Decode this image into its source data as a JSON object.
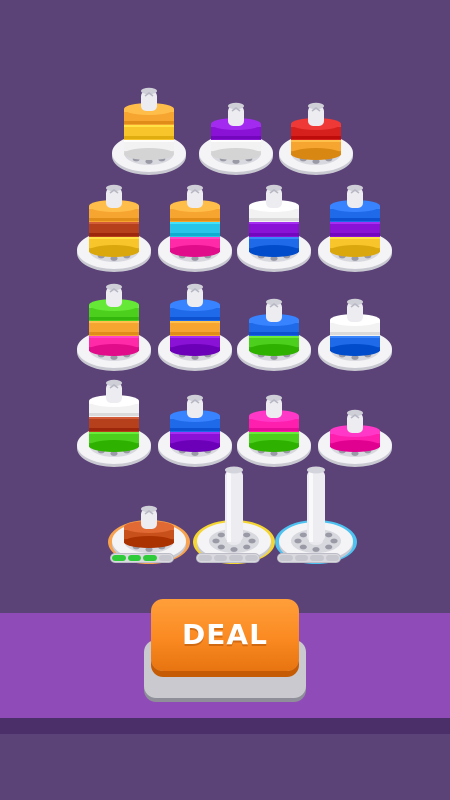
{
  "colors": {
    "background": "#5b4277",
    "stripe": "#8f4bb8",
    "deal_button": "#fb8a22",
    "progress_fill": "#2ecb3a"
  },
  "palette": {
    "orange": "#f7a531",
    "purple": "#8a12d6",
    "red": "#d6201d",
    "yellow": "#f8c52a",
    "white": "#f2f2f2",
    "cyan": "#27c6e8",
    "pink": "#ff2aa8",
    "blue": "#1f6ae8",
    "green": "#4dcf1e",
    "brown": "#b5401b",
    "magenta": "#ff1fae",
    "rust": "#c8501b"
  },
  "spools": [
    {
      "id": "r1c1",
      "stack": [
        "white",
        "yellow",
        "orange"
      ],
      "ring": null
    },
    {
      "id": "r1c2",
      "stack": [
        "white",
        "purple"
      ],
      "ring": null
    },
    {
      "id": "r1c3",
      "stack": [
        "orange",
        "red"
      ],
      "ring": null
    },
    {
      "id": "r2c1",
      "stack": [
        "yellow",
        "brown",
        "orange"
      ],
      "ring": null
    },
    {
      "id": "r2c2",
      "stack": [
        "pink",
        "cyan",
        "orange"
      ],
      "ring": null
    },
    {
      "id": "r2c3",
      "stack": [
        "blue",
        "purple",
        "white"
      ],
      "ring": null
    },
    {
      "id": "r3c4",
      "stack": [
        "yellow",
        "purple",
        "blue"
      ],
      "ring": null
    },
    {
      "id": "r3c1",
      "stack": [
        "pink",
        "orange",
        "green"
      ],
      "ring": null
    },
    {
      "id": "r3c2",
      "stack": [
        "purple",
        "orange",
        "blue"
      ],
      "ring": null
    },
    {
      "id": "r3c3",
      "stack": [
        "green",
        "blue"
      ],
      "ring": null
    },
    {
      "id": "r3c4b",
      "stack": [
        "blue",
        "white"
      ],
      "ring": null
    },
    {
      "id": "r4c1",
      "stack": [
        "green",
        "brown",
        "white"
      ],
      "ring": null
    },
    {
      "id": "r4c2",
      "stack": [
        "purple",
        "blue"
      ],
      "ring": null
    },
    {
      "id": "r4c3",
      "stack": [
        "green",
        "magenta"
      ],
      "ring": null
    },
    {
      "id": "r4c4",
      "stack": [
        "magenta"
      ],
      "ring": null
    },
    {
      "id": "r5c1",
      "stack": [
        "rust"
      ],
      "ring": "#f7a24e"
    },
    {
      "id": "r5c2",
      "stack": [],
      "ring": "#f4d531"
    },
    {
      "id": "r5c3",
      "stack": [],
      "ring": "#4ec2f0"
    }
  ],
  "progress_bars": [
    {
      "segments": 4,
      "filled": 3
    },
    {
      "segments": 4,
      "filled": 0
    },
    {
      "segments": 4,
      "filled": 0
    }
  ],
  "deal": {
    "label": "DEAL"
  }
}
